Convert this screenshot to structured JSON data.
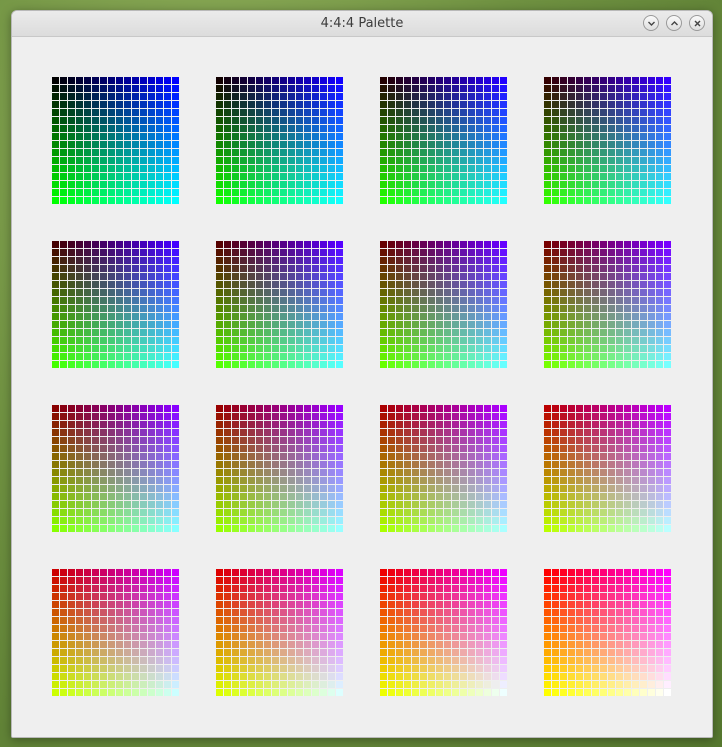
{
  "window": {
    "title": "4:4:4 Palette",
    "buttons": [
      {
        "name": "minimize",
        "icon": "chevron-down-icon"
      },
      {
        "name": "maximize",
        "icon": "chevron-up-icon"
      },
      {
        "name": "close",
        "icon": "close-icon"
      }
    ]
  },
  "palette": {
    "levels": 16,
    "blocks": [
      {
        "red": 0
      },
      {
        "red": 1
      },
      {
        "red": 2
      },
      {
        "red": 3
      },
      {
        "red": 4
      },
      {
        "red": 5
      },
      {
        "red": 6
      },
      {
        "red": 7
      },
      {
        "red": 8
      },
      {
        "red": 9
      },
      {
        "red": 10
      },
      {
        "red": 11
      },
      {
        "red": 12
      },
      {
        "red": 13
      },
      {
        "red": 14
      },
      {
        "red": 15
      }
    ],
    "row_channel": "green",
    "column_channel": "blue",
    "block_channel": "red"
  }
}
